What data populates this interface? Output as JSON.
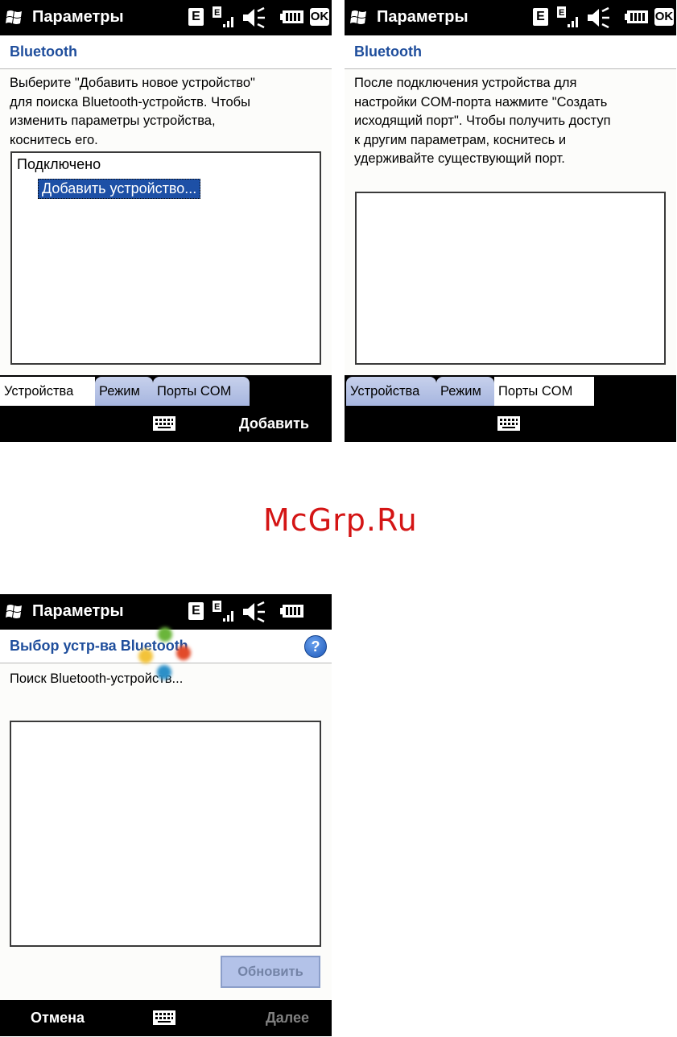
{
  "colors": {
    "header_title": "#1f4e9c",
    "selection": "#1d50a6",
    "tab_inactive": "#a6b5df",
    "watermark": "#d41515",
    "dot_green": "#6ab53a",
    "dot_red": "#e24a2a",
    "dot_yellow": "#f3c33a",
    "dot_blue": "#2c90c8"
  },
  "watermark": "McGrp.Ru",
  "screen1": {
    "titlebar": {
      "title": "Параметры",
      "icons": [
        "windows-flag-icon",
        "edge-e-icon",
        "signal-icon",
        "speaker-muted-icon",
        "battery-icon"
      ],
      "e_label": "E",
      "ok_label": "OK"
    },
    "header": "Bluetooth",
    "description": [
      "Выберите \"Добавить новое устройство\"",
      "для поиска Bluetooth-устройств. Чтобы",
      "изменить параметры устройства,",
      "коснитесь его."
    ],
    "tree": {
      "root": "Подключено",
      "child": "Добавить устройство..."
    },
    "tabs": [
      "Устройства",
      "Режим",
      "Порты COM"
    ],
    "active_tab": "Устройства",
    "softkeys": {
      "right": "Добавить"
    }
  },
  "screen2": {
    "titlebar": {
      "title": "Параметры",
      "e_label": "E",
      "ok_label": "OK"
    },
    "header": "Bluetooth",
    "description": [
      "После подключения устройства для",
      "настройки COM-порта нажмите \"Создать",
      "исходящий порт\". Чтобы получить доступ",
      "к другим параметрам, коснитесь и",
      "удерживайте существующий порт."
    ],
    "tabs": [
      "Устройства",
      "Режим",
      "Порты COM"
    ],
    "active_tab": "Порты COM"
  },
  "screen3": {
    "titlebar": {
      "title": "Параметры",
      "e_label": "E"
    },
    "header": "Выбор устр-ва Bluetooth",
    "help_label": "?",
    "status": "Поиск Bluetooth-устройств...",
    "refresh_button": "Обновить",
    "softkeys": {
      "left": "Отмена",
      "right": "Далее"
    }
  }
}
